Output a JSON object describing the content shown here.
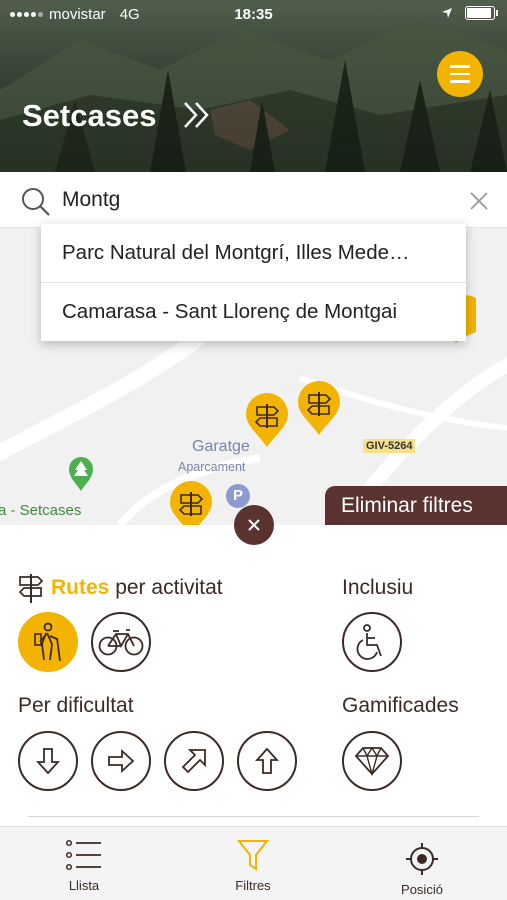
{
  "status_bar": {
    "carrier": "movistar",
    "network": "4G",
    "time": "18:35"
  },
  "header": {
    "title": "Setcases",
    "chevron_icon": "double-chevron-right-icon",
    "menu_icon": "hamburger-menu-icon"
  },
  "search": {
    "value": "Montg",
    "placeholder": "",
    "search_icon": "search-icon",
    "clear_icon": "close-icon"
  },
  "suggestions": [
    "Parc Natural del Montgrí, Illes Mede…",
    "Camarasa - Sant Llorenç de Montgai"
  ],
  "map": {
    "poi_garatge": "Garatge",
    "poi_aparcament": "Aparcament",
    "road_label": "GIV-5264",
    "place_label": "a - Setcases",
    "parking_letter": "P"
  },
  "remove_filters_label": "Eliminar filtres",
  "filters": {
    "routes_accent": "Rutes",
    "routes_rest": "per activitat",
    "inclusive": "Inclusiu",
    "difficulty": "Per dificultat",
    "gamified": "Gamificades",
    "activity_options": [
      {
        "icon": "hiking-icon",
        "active": true
      },
      {
        "icon": "bicycle-icon",
        "active": false
      }
    ],
    "difficulty_options": [
      {
        "icon": "arrow-down-icon"
      },
      {
        "icon": "arrow-right-icon"
      },
      {
        "icon": "arrow-up-right-icon"
      },
      {
        "icon": "arrow-up-icon"
      }
    ],
    "inclusive_icon": "wheelchair-icon",
    "gamified_icon": "diamond-icon"
  },
  "tabs": [
    {
      "label": "Llista",
      "icon": "list-icon"
    },
    {
      "label": "Filtres",
      "icon": "filter-icon",
      "active": true
    },
    {
      "label": "Posició",
      "icon": "location-target-icon"
    }
  ],
  "colors": {
    "accent": "#f2b400",
    "dark_brown": "#5a3331",
    "text": "#3b2b26"
  }
}
